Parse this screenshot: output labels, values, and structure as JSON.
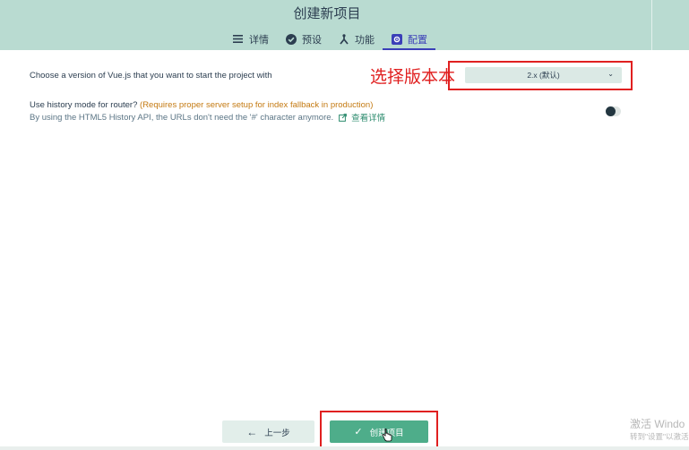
{
  "header": {
    "title": "创建新项目",
    "tabs": [
      {
        "label": "详情",
        "icon": "list-icon",
        "active": false
      },
      {
        "label": "预设",
        "icon": "check-circle-icon",
        "active": false
      },
      {
        "label": "功能",
        "icon": "fork-icon",
        "active": false
      },
      {
        "label": "配置",
        "icon": "gear-square-icon",
        "active": true
      }
    ]
  },
  "config": {
    "vue_version_label": "Choose a version of Vue.js that you want to start the project with",
    "vue_version_value": "2.x (默认)",
    "history_label": "Use history mode for router?",
    "history_warning": "(Requires proper server setup for index fallback in production)",
    "history_desc": "By using the HTML5 History API, the URLs don't need the '#' character anymore.",
    "history_link": "查看详情",
    "history_enabled": false
  },
  "annotations": {
    "version_note": "选择版本本"
  },
  "footer": {
    "prev_label": "上一步",
    "create_label": "创建项目"
  },
  "watermark": {
    "line1": "激活 Windo",
    "line2": "转到\"设置\"以激活"
  },
  "colors": {
    "header_bg": "#b9dbd1",
    "accent": "#4ead8a",
    "active_tab": "#3b3fb8",
    "annotation": "#e02020",
    "warning": "#c47a12"
  }
}
